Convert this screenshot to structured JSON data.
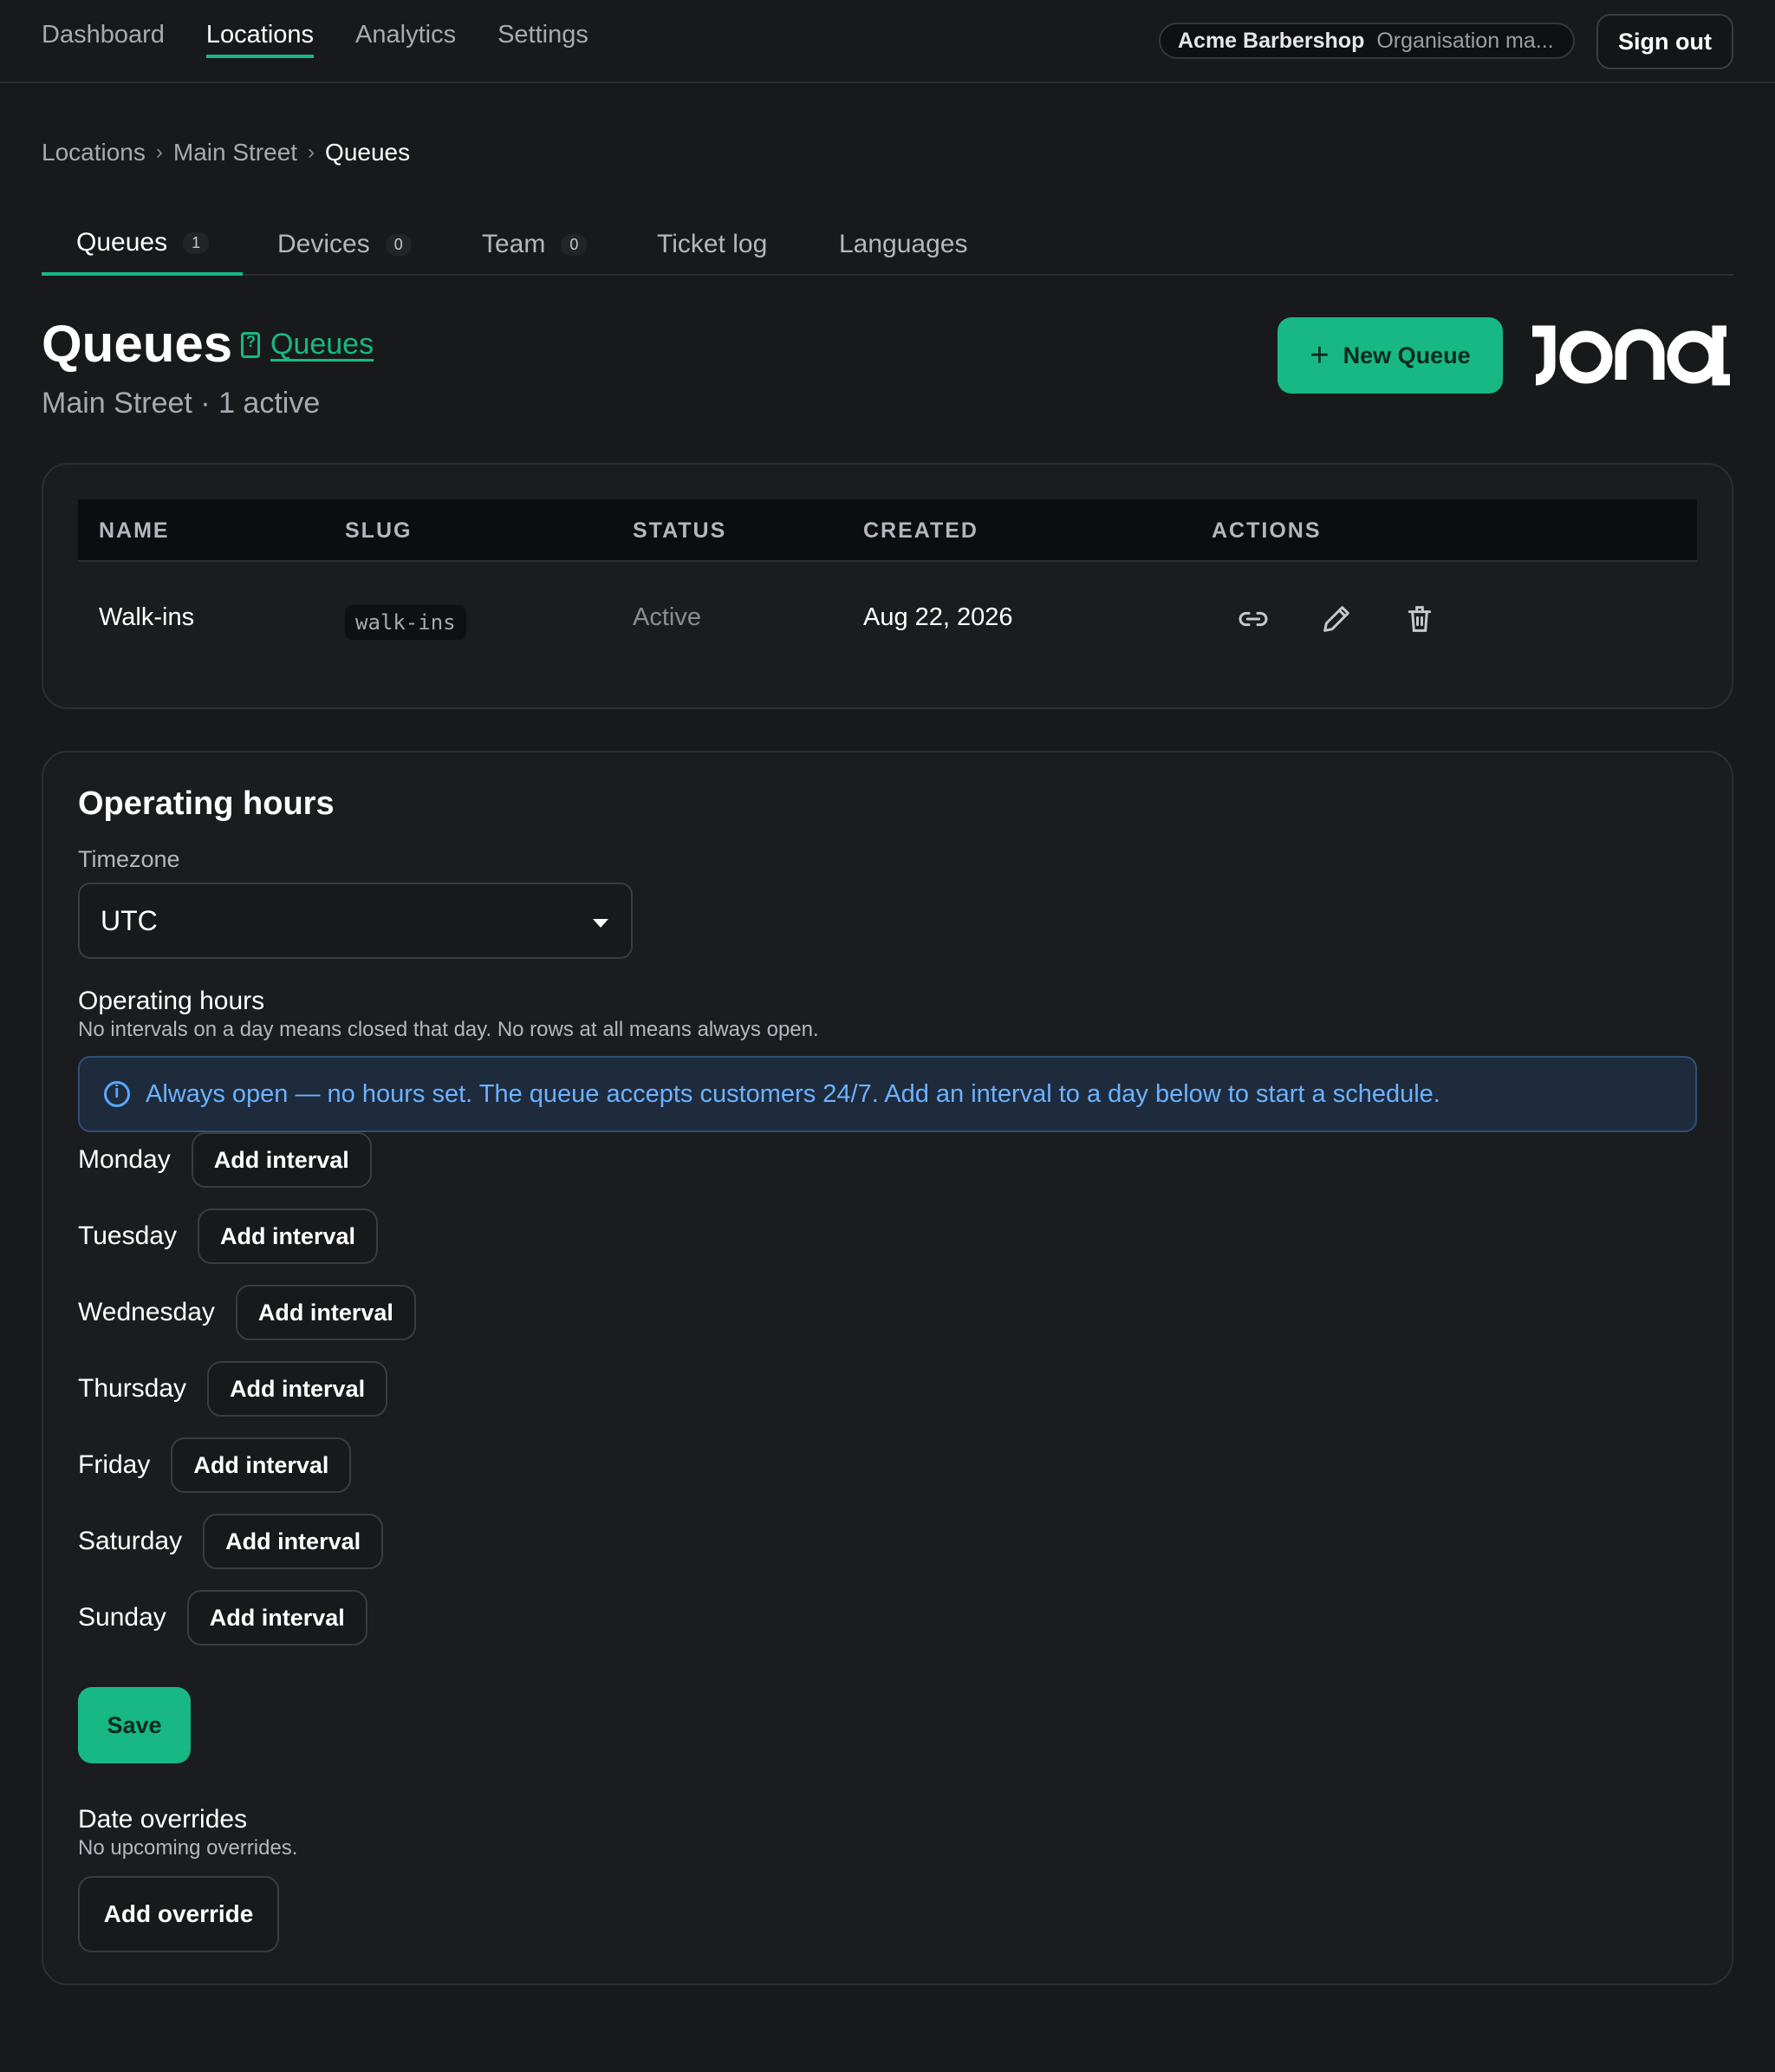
{
  "nav": {
    "links": [
      "Dashboard",
      "Locations",
      "Analytics",
      "Settings"
    ],
    "active": "Locations",
    "org_name": "Acme Barbershop",
    "org_role": "Organisation ma...",
    "sign_out": "Sign out"
  },
  "breadcrumb": [
    "Locations",
    "Main Street",
    "Queues"
  ],
  "tabs": [
    {
      "label": "Queues",
      "badge": "1"
    },
    {
      "label": "Devices",
      "badge": "0"
    },
    {
      "label": "Team",
      "badge": "0"
    },
    {
      "label": "Ticket log"
    },
    {
      "label": "Languages"
    }
  ],
  "header": {
    "title": "Queues",
    "doc_link": "Queues",
    "subtitle": "Main Street · 1 active",
    "new_queue": "New Queue",
    "logo_text": "JONOT"
  },
  "table": {
    "columns": [
      "NAME",
      "SLUG",
      "STATUS",
      "CREATED",
      "ACTIONS"
    ],
    "rows": [
      {
        "name": "Walk-ins",
        "slug": "walk-ins",
        "status": "Active",
        "created": "Aug 22, 2026",
        "actions": [
          "link-icon",
          "pencil-icon",
          "trash-icon"
        ]
      }
    ]
  },
  "hours": {
    "title": "Operating hours",
    "timezone_label": "Timezone",
    "timezone_value": "UTC",
    "subheading": "Operating hours",
    "hint": "No intervals on a day means closed that day. No rows at all means always open.",
    "banner": "Always open — no hours set. The queue accepts customers 24/7. Add an interval to a day below to start a schedule.",
    "days": [
      "Monday",
      "Tuesday",
      "Wednesday",
      "Thursday",
      "Friday",
      "Saturday",
      "Sunday"
    ],
    "add_interval": "Add interval",
    "save": "Save",
    "overrides_title": "Date overrides",
    "overrides_hint": "No upcoming overrides.",
    "add_override": "Add override"
  },
  "colors": {
    "accent": "#17b884",
    "background": "#18191b",
    "info": "#6db2ff"
  }
}
